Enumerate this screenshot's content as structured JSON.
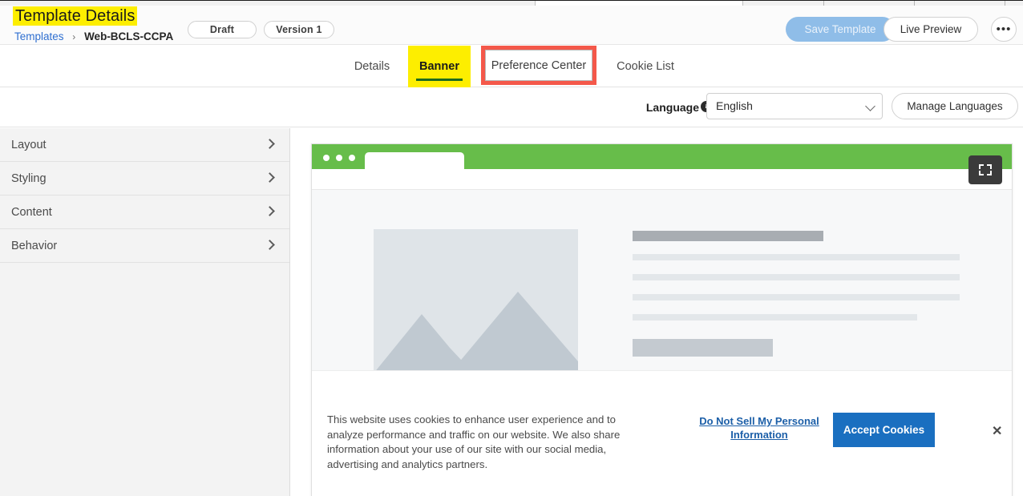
{
  "header": {
    "title": "Template Details",
    "breadcrumb": {
      "root": "Templates",
      "separator": "›",
      "current": "Web-BCLS-CCPA"
    },
    "status_pill": "Draft",
    "version_pill": "Version 1",
    "save_button": "Save Template",
    "live_preview_button": "Live Preview",
    "more_button": "•••",
    "save_button_enabled": false,
    "title_highlight_color": "#fdee00"
  },
  "tabs": {
    "items": [
      {
        "label": "Details",
        "active": false
      },
      {
        "label": "Banner",
        "active": true
      },
      {
        "label": "Preference Center",
        "active": false
      },
      {
        "label": "Cookie List",
        "active": false
      }
    ],
    "active_underline_color": "#1d6b1d",
    "annotation_box_color": "#f4584a",
    "annotated_tab": "Preference Center"
  },
  "language_bar": {
    "label": "Language",
    "info_icon": "info-icon",
    "selected": "English",
    "manage_button": "Manage Languages"
  },
  "sidebar": {
    "items": [
      {
        "label": "Layout",
        "icon": "chevron-right-icon"
      },
      {
        "label": "Styling",
        "icon": "chevron-right-icon"
      },
      {
        "label": "Content",
        "icon": "chevron-right-icon"
      },
      {
        "label": "Behavior",
        "icon": "chevron-right-icon"
      }
    ]
  },
  "preview": {
    "browser_bar_color": "#67bd4a",
    "fullscreen_icon": "fullscreen-expand-icon",
    "placeholder": {
      "image_block": "image-placeholder",
      "heading_block": "heading-placeholder",
      "text_lines": 4,
      "button_block": "button-placeholder"
    },
    "cookie_banner": {
      "body_text": "This website uses cookies to enhance user experience and to analyze performance and traffic on our website. We also share information about your use of our site with our social media, advertising and analytics partners.",
      "link_text": "Do Not Sell My Personal Information",
      "accept_button": "Accept Cookies",
      "close_icon": "✕",
      "accept_button_color": "#1a6fc0",
      "link_color": "#1c5fa8"
    }
  }
}
